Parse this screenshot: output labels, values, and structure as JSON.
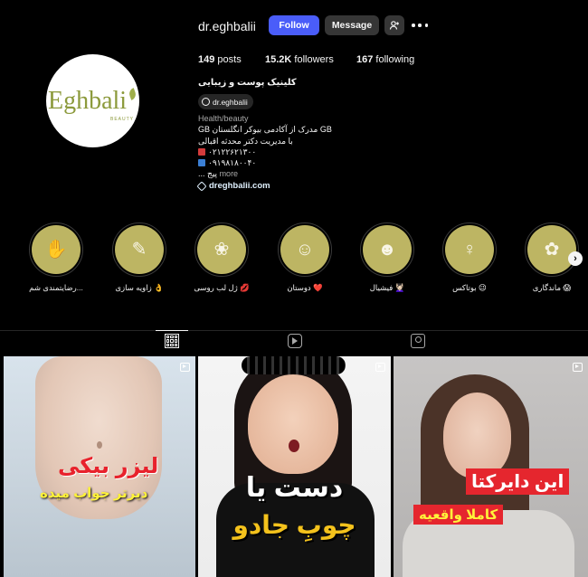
{
  "profile": {
    "username": "dr.eghbalii",
    "follow_label": "Follow",
    "message_label": "Message",
    "avatar": {
      "logo_text": "Eghbali",
      "logo_sub": "BEAUTY"
    },
    "stats": {
      "posts_count": "149",
      "posts_label": "posts",
      "followers_count": "15.2K",
      "followers_label": "followers",
      "following_count": "167",
      "following_label": "following"
    },
    "full_name": "کلینیک پوست و زیبایی",
    "threads_handle": "dr.eghbalii",
    "category": "Health/beauty",
    "bio": {
      "line1": "GB مدرک از آکادمی بیوکر انگلستان GB",
      "line2": "با مدیریت دکتر محدثه اقبالی",
      "line3": "۰۲۱۲۲۶۲۱۳۰۰",
      "line4": "۰۹۱۹۸۱۸۰۰۴۰",
      "line5": "... پیج",
      "more_label": "more"
    },
    "website": "dreghbalii.com",
    "colors": {
      "follow_button": "#4a5df9",
      "secondary_button": "#363636",
      "highlight_fill": "#bdb563",
      "logo_green": "#8c9a3c"
    }
  },
  "highlights": [
    {
      "label": "رضایتمندی شم...",
      "icon": "hand-product-icon",
      "glyph": "✋"
    },
    {
      "label": "زاویه سازی 👌",
      "icon": "face-contour-icon",
      "glyph": "✎"
    },
    {
      "label": "ژل لب روسی 💋",
      "icon": "lips-icon",
      "glyph": "❀"
    },
    {
      "label": "دوستان ❤️",
      "icon": "group-icon",
      "glyph": "☺"
    },
    {
      "label": "فیشیال 💆🏻‍♀️",
      "icon": "face-icon",
      "glyph": "☻"
    },
    {
      "label": "بوتاکس 😉",
      "icon": "woman-profile-icon",
      "glyph": "♀"
    },
    {
      "label": "ماندگاری 😱",
      "icon": "lotus-icon",
      "glyph": "✿"
    }
  ],
  "tabs": [
    {
      "name": "posts",
      "icon": "grid-icon",
      "active": true
    },
    {
      "name": "reels",
      "icon": "reels-icon",
      "active": false
    },
    {
      "name": "tagged",
      "icon": "tagged-icon",
      "active": false
    }
  ],
  "posts": [
    {
      "title": "لیزر بیکی",
      "subtitle": "دیرتر جواب میده",
      "type": "reel"
    },
    {
      "title": "دست یا",
      "subtitle": "چوبِ جادو",
      "type": "reel"
    },
    {
      "title": "این دایرکتا",
      "subtitle": "کاملا واقعیه",
      "type": "reel"
    }
  ]
}
